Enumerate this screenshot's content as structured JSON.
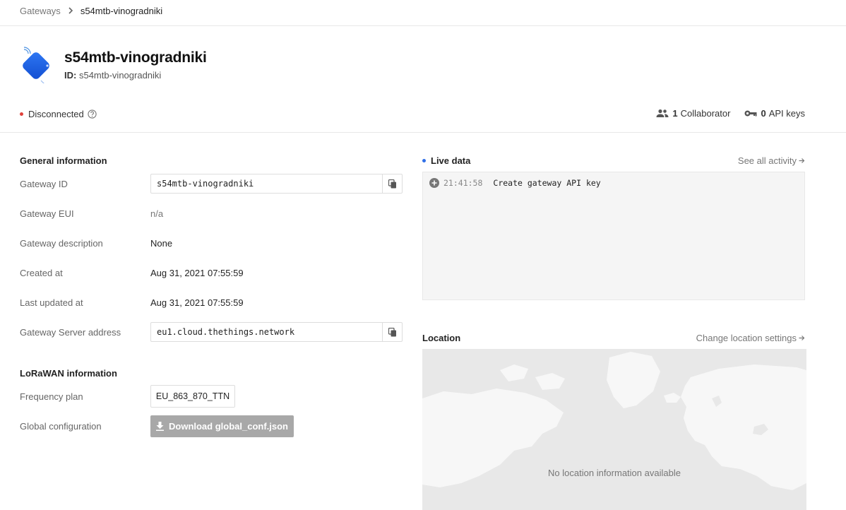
{
  "breadcrumb": {
    "parent": "Gateways",
    "current": "s54mtb-vinogradniki"
  },
  "header": {
    "title": "s54mtb-vinogradniki",
    "id_label": "ID:",
    "id_value": "s54mtb-vinogradniki",
    "status": "Disconnected",
    "collaborators_count": "1",
    "collaborators_label": "Collaborator",
    "api_keys_count": "0",
    "api_keys_label": "API keys"
  },
  "general": {
    "title": "General information",
    "gateway_id_label": "Gateway ID",
    "gateway_id_value": "s54mtb-vinogradniki",
    "gateway_eui_label": "Gateway EUI",
    "gateway_eui_value": "n/a",
    "description_label": "Gateway description",
    "description_value": "None",
    "created_label": "Created at",
    "created_value": "Aug 31, 2021 07:55:59",
    "updated_label": "Last updated at",
    "updated_value": "Aug 31, 2021 07:55:59",
    "server_label": "Gateway Server address",
    "server_value": "eu1.cloud.thethings.network"
  },
  "lorawan": {
    "title": "LoRaWAN information",
    "freq_label": "Frequency plan",
    "freq_value": "EU_863_870_TTN",
    "global_conf_label": "Global configuration",
    "download_label": "Download global_conf.json"
  },
  "live": {
    "title": "Live data",
    "see_all": "See all activity",
    "events": [
      {
        "time": "21:41:58",
        "text": "Create gateway API key"
      }
    ]
  },
  "location": {
    "title": "Location",
    "change": "Change location settings",
    "empty": "No location information available"
  },
  "colors": {
    "status_disconnected": "#e0413b",
    "live_dot": "#2f6fe7",
    "icon_blue": "#1a5fe6"
  }
}
